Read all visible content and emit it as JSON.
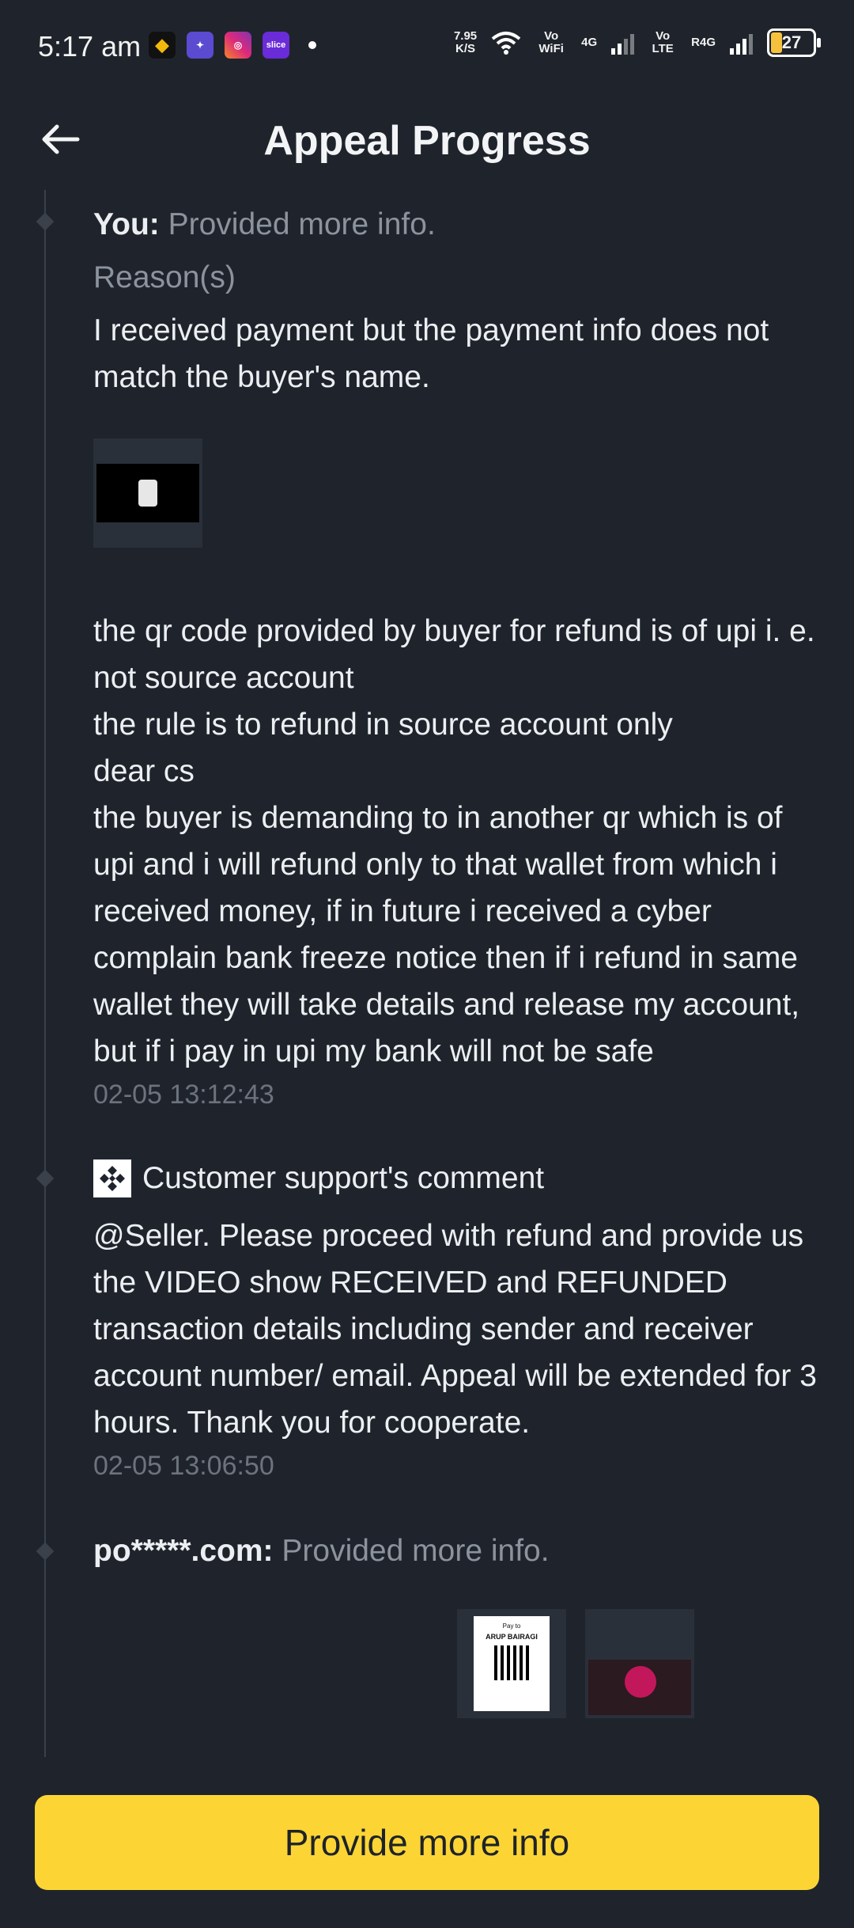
{
  "status_bar": {
    "time": "5:17 am",
    "net_speed_value": "7.95",
    "net_speed_unit": "K/S",
    "vowifi": "Vo WiFi",
    "net1": "4G",
    "volte": "Vo LTE",
    "net2": "R4G",
    "battery": "27",
    "apps": [
      "binance-icon",
      "game-icon",
      "instagram-icon",
      "slice-icon"
    ],
    "slice_label": "slice"
  },
  "header": {
    "title": "Appeal Progress"
  },
  "timeline": [
    {
      "actor": "You:",
      "action": "Provided more info.",
      "reason_label": "Reason(s)",
      "reason": "I received payment but the payment info does not match the buyer's name.",
      "message": [
        "the qr code provided by buyer for refund is of upi i. e. not source account",
        "the rule is to refund in source account only",
        "dear cs",
        "the buyer is demanding to  in another qr which is of upi  and i will refund only to that wallet from which i received money, if in future i received a cyber complain bank freeze notice then if i refund in same wallet they will take details and release my account, but if i pay in upi my bank will not be safe"
      ],
      "timestamp": "02-05 13:12:43"
    },
    {
      "heading": "Customer support's comment",
      "message": "@Seller. Please proceed with refund and provide us the VIDEO show RECEIVED and REFUNDED transaction details including sender and receiver account number/ email. Appeal will be extended for 3 hours. Thank you for cooperate.",
      "timestamp": "02-05 13:06:50"
    },
    {
      "actor": "po*****.com:",
      "action": "Provided more info.",
      "attachment_text": [
        "Pay to",
        "ARUP BAIRAGI"
      ]
    }
  ],
  "footer": {
    "button_label": "Provide more info"
  },
  "colors": {
    "accent": "#fcd535",
    "background": "#1f242c",
    "muted": "#8c939d"
  }
}
